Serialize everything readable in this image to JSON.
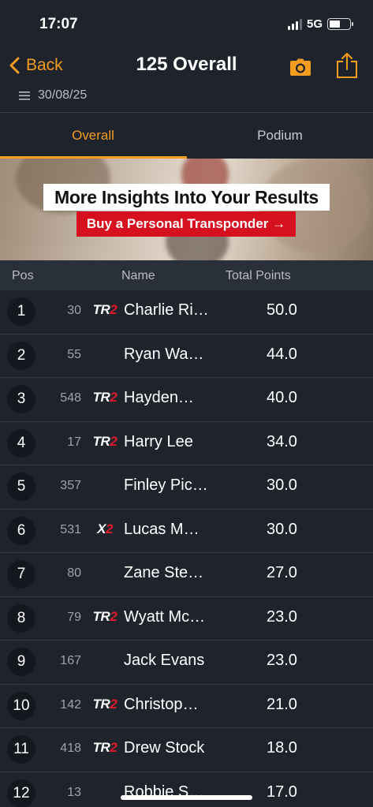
{
  "status_bar": {
    "time": "17:07",
    "network": "5G"
  },
  "nav": {
    "back_label": "Back",
    "title": "125 Overall",
    "date": "30/08/25",
    "accent_color": "#f39c1f"
  },
  "tabs": [
    {
      "label": "Overall",
      "active": true
    },
    {
      "label": "Podium",
      "active": false
    }
  ],
  "banner": {
    "title": "More Insights Into Your Results",
    "cta": "Buy a Personal Transponder →"
  },
  "table": {
    "headers": {
      "pos": "Pos",
      "name": "Name",
      "points": "Total Points"
    },
    "rows": [
      {
        "pos": "1",
        "number": "30",
        "tag": "TR2",
        "name": "Charlie Ri…",
        "points": "50.0"
      },
      {
        "pos": "2",
        "number": "55",
        "tag": "",
        "name": "Ryan Wa…",
        "points": "44.0"
      },
      {
        "pos": "3",
        "number": "548",
        "tag": "TR2",
        "name": "Hayden…",
        "points": "40.0"
      },
      {
        "pos": "4",
        "number": "17",
        "tag": "TR2",
        "name": "Harry Lee",
        "points": "34.0"
      },
      {
        "pos": "5",
        "number": "357",
        "tag": "",
        "name": "Finley Pic…",
        "points": "30.0"
      },
      {
        "pos": "6",
        "number": "531",
        "tag": "X2",
        "name": "Lucas M…",
        "points": "30.0"
      },
      {
        "pos": "7",
        "number": "80",
        "tag": "",
        "name": "Zane Ste…",
        "points": "27.0"
      },
      {
        "pos": "8",
        "number": "79",
        "tag": "TR2",
        "name": "Wyatt Mc…",
        "points": "23.0"
      },
      {
        "pos": "9",
        "number": "167",
        "tag": "",
        "name": "Jack Evans",
        "points": "23.0"
      },
      {
        "pos": "10",
        "number": "142",
        "tag": "TR2",
        "name": "Christop…",
        "points": "21.0"
      },
      {
        "pos": "11",
        "number": "418",
        "tag": "TR2",
        "name": "Drew Stock",
        "points": "18.0"
      },
      {
        "pos": "12",
        "number": "13",
        "tag": "",
        "name": "Robbie S…",
        "points": "17.0"
      }
    ]
  }
}
